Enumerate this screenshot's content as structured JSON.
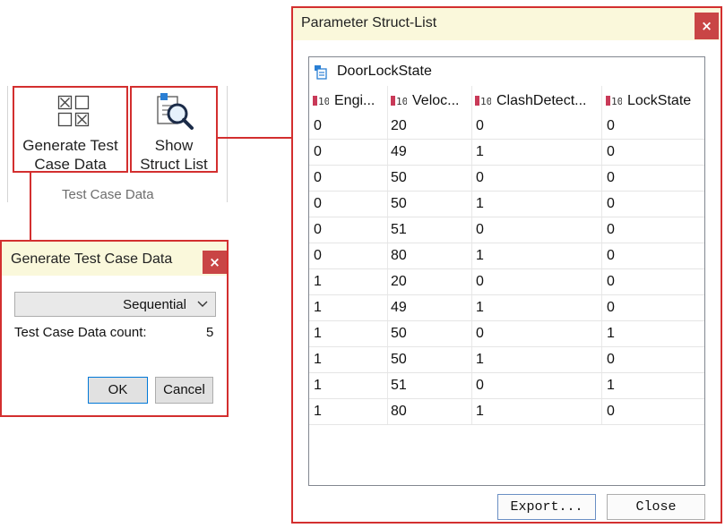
{
  "ribbon": {
    "generate_button_label_line1": "Generate Test",
    "generate_button_label_line2": "Case Data",
    "show_button_label_line1": "Show",
    "show_button_label_line2": "Struct List",
    "group_label": "Test Case Data"
  },
  "generate_dialog": {
    "title": "Generate Test Case Data",
    "close_glyph": "×",
    "mode_value": "Sequential",
    "count_label": "Test Case Data count:",
    "count_value": "5",
    "ok_label": "OK",
    "cancel_label": "Cancel"
  },
  "struct_dialog": {
    "title": "Parameter Struct-List",
    "close_glyph": "×",
    "struct_name": "DoorLockState",
    "columns": [
      "Engi...",
      "Veloc...",
      "ClashDetect...",
      "LockState"
    ],
    "rows": [
      [
        "0",
        "20",
        "0",
        "0"
      ],
      [
        "0",
        "49",
        "1",
        "0"
      ],
      [
        "0",
        "50",
        "0",
        "0"
      ],
      [
        "0",
        "50",
        "1",
        "0"
      ],
      [
        "0",
        "51",
        "0",
        "0"
      ],
      [
        "0",
        "80",
        "1",
        "0"
      ],
      [
        "1",
        "20",
        "0",
        "0"
      ],
      [
        "1",
        "49",
        "1",
        "0"
      ],
      [
        "1",
        "50",
        "0",
        "1"
      ],
      [
        "1",
        "50",
        "1",
        "0"
      ],
      [
        "1",
        "51",
        "0",
        "1"
      ],
      [
        "1",
        "80",
        "1",
        "0"
      ]
    ],
    "export_label": "Export...",
    "close_label": "Close"
  },
  "colors": {
    "highlight": "#d32f2f",
    "title_bar": "#faf8db",
    "close_button": "#c94545"
  }
}
